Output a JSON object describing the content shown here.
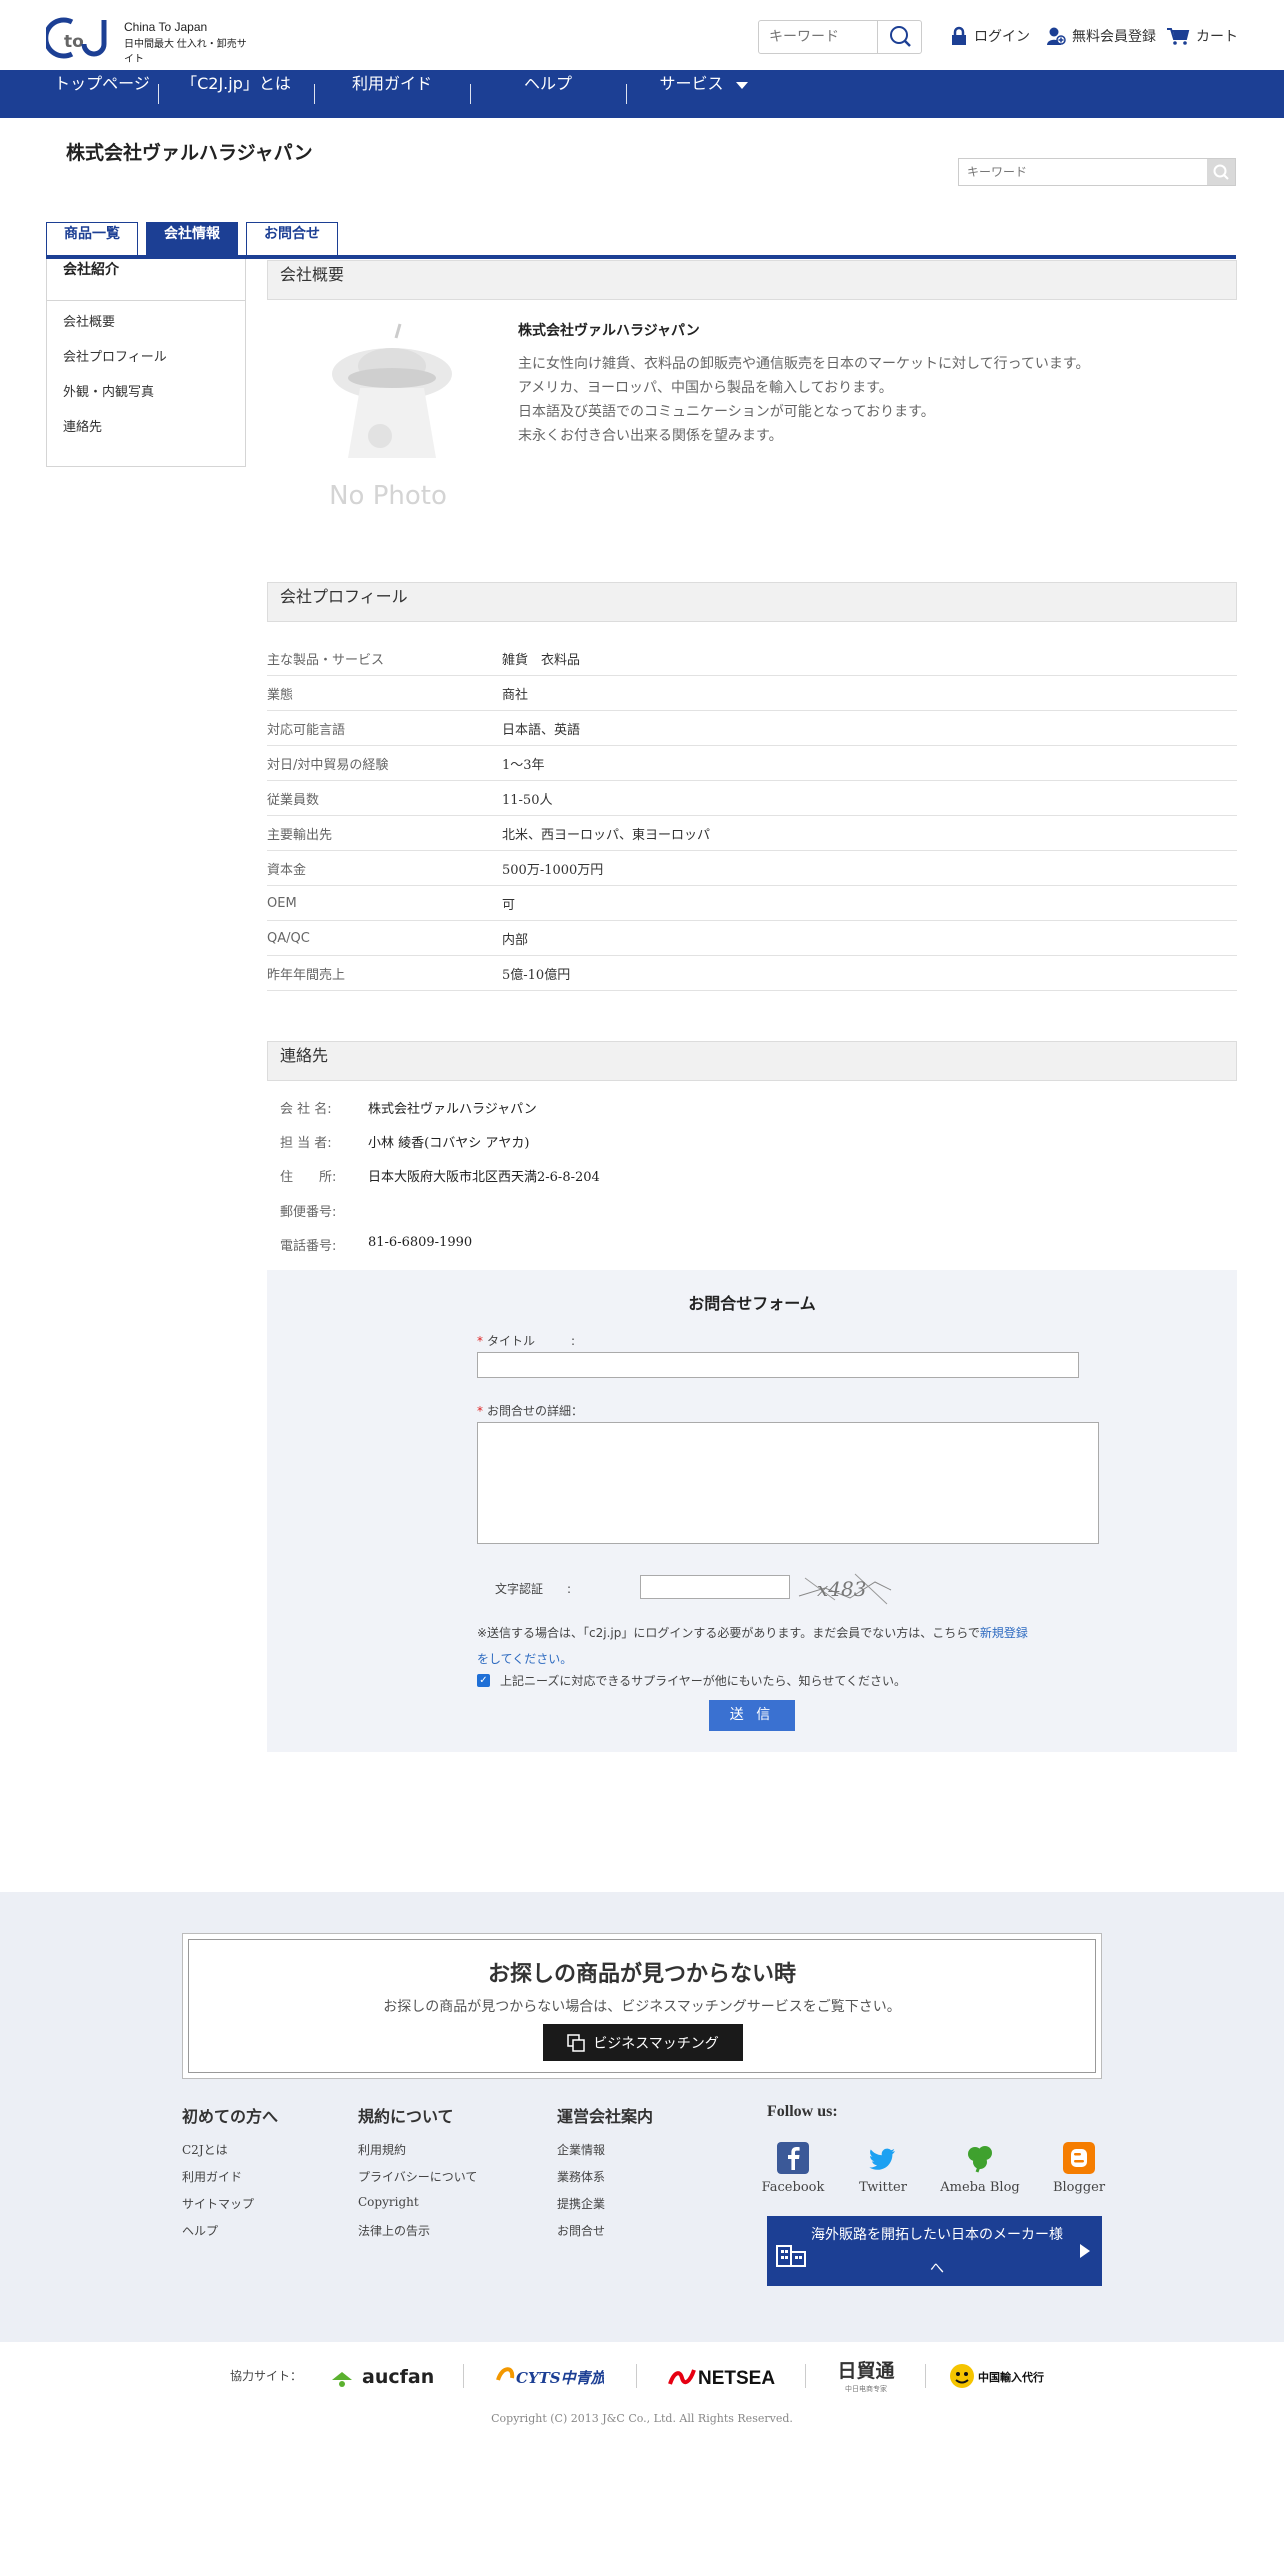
{
  "header": {
    "logo_line1": "China To Japan",
    "logo_line2": "日中間最大 仕入れ・卸売サイト",
    "search_placeholder": "キーワード",
    "login": "ログイン",
    "register": "無料会員登録",
    "cart": "カート"
  },
  "nav": {
    "items": [
      "トップページ",
      "「C2J.jp」とは",
      "利用ガイド",
      "ヘルプ",
      "サービス"
    ]
  },
  "company": {
    "name": "株式会社ヴァルハラジャパン",
    "search_placeholder": "キーワード"
  },
  "tabs": [
    "商品一覧",
    "会社情報",
    "お問合せ"
  ],
  "sidebar": {
    "heading": "会社紹介",
    "items": [
      "会社概要",
      "会社プロフィール",
      "外観・内観写真",
      "連絡先"
    ]
  },
  "overview": {
    "section_title": "会社概要",
    "photo_label": "No Photo",
    "name": "株式会社ヴァルハラジャパン",
    "lines": [
      "主に女性向け雑貨、衣料品の卸販売や通信販売を日本のマーケットに対して行っています。",
      "アメリカ、ヨーロッパ、中国から製品を輸入しております。",
      "日本語及び英語でのコミュニケーションが可能となっております。",
      "末永くお付き合い出来る関係を望みます。"
    ]
  },
  "profile": {
    "section_title": "会社プロフィール",
    "rows": [
      {
        "k": "主な製品・サービス",
        "v": "雑貨　衣料品"
      },
      {
        "k": "業態",
        "v": "商社"
      },
      {
        "k": "対応可能言語",
        "v": "日本語、英語"
      },
      {
        "k": "対日/対中貿易の経験",
        "v": "1～3年"
      },
      {
        "k": "従業員数",
        "v": "11-50人"
      },
      {
        "k": "主要輸出先",
        "v": "北米、西ヨーロッパ、東ヨーロッパ"
      },
      {
        "k": "資本金",
        "v": "500万-1000万円"
      },
      {
        "k": "OEM",
        "v": "可"
      },
      {
        "k": "QA/QC",
        "v": "内部"
      },
      {
        "k": "昨年年間売上",
        "v": "5億-10億円"
      }
    ]
  },
  "contact": {
    "section_title": "連絡先",
    "rows": [
      {
        "k": "会 社 名:",
        "v": "株式会社ヴァルハラジャパン"
      },
      {
        "k": "担 当 者:",
        "v": "小林 綾香(コバヤシ アヤカ)"
      },
      {
        "k": "住　　所:",
        "v": "日本大阪府大阪市北区西天満2-6-8-204"
      },
      {
        "k": "郵便番号:",
        "v": ""
      },
      {
        "k": "電話番号:",
        "v": "81-6-6809-1990"
      }
    ]
  },
  "form": {
    "title": "お問合せフォーム",
    "title_label": "タイトル　　　:",
    "detail_label": "お問合せの詳細：",
    "captcha_label": "文字認証　　:",
    "captcha_text": "x483",
    "required_mark": "*",
    "note_before": "※送信する場合は、「c2j.jp」にログインする必要があります。まだ会員でない方は、こちらで",
    "note_link": "新規登録をしてください。",
    "checkbox_label": "上記ニーズに対応できるサプライヤーが他にもいたら、知らせてください。",
    "submit": "送 信"
  },
  "matching": {
    "title": "お探しの商品が見つからない時",
    "subtitle": "お探しの商品が見つからない場合は、ビジネスマッチングサービスをご覧下さい。",
    "button": "ビジネスマッチング"
  },
  "footer": {
    "columns": [
      {
        "heading": "初めての方へ",
        "links": [
          "C2Jとは",
          "利用ガイド",
          "サイトマップ",
          "ヘルプ"
        ]
      },
      {
        "heading": "規約について",
        "links": [
          "利用規約",
          "プライバシーについて",
          "Copyright",
          "法律上の告示"
        ]
      },
      {
        "heading": "運営会社案内",
        "links": [
          "企業情報",
          "業務体系",
          "提携企業",
          "お問合せ"
        ]
      }
    ],
    "follow_heading": "Follow us:",
    "social": [
      "Facebook",
      "Twitter",
      "Ameba Blog",
      "Blogger"
    ],
    "maker_line1": "海外販路を開拓したい日本のメーカー様",
    "maker_line2": "へ",
    "partners_label": "協力サイト：",
    "partners": [
      "aucfan",
      "CYTS中青旅",
      "NETSEA",
      "日貿通",
      "中国輸入代行"
    ],
    "partner_sub": "中日电商专家",
    "copyright": "Copyright (C) 2013 J&C Co., Ltd. All Rights Reserved."
  },
  "colors": {
    "brand": "#1c3f94",
    "button": "#3a71d1",
    "footer_bg": "#eceff5"
  }
}
